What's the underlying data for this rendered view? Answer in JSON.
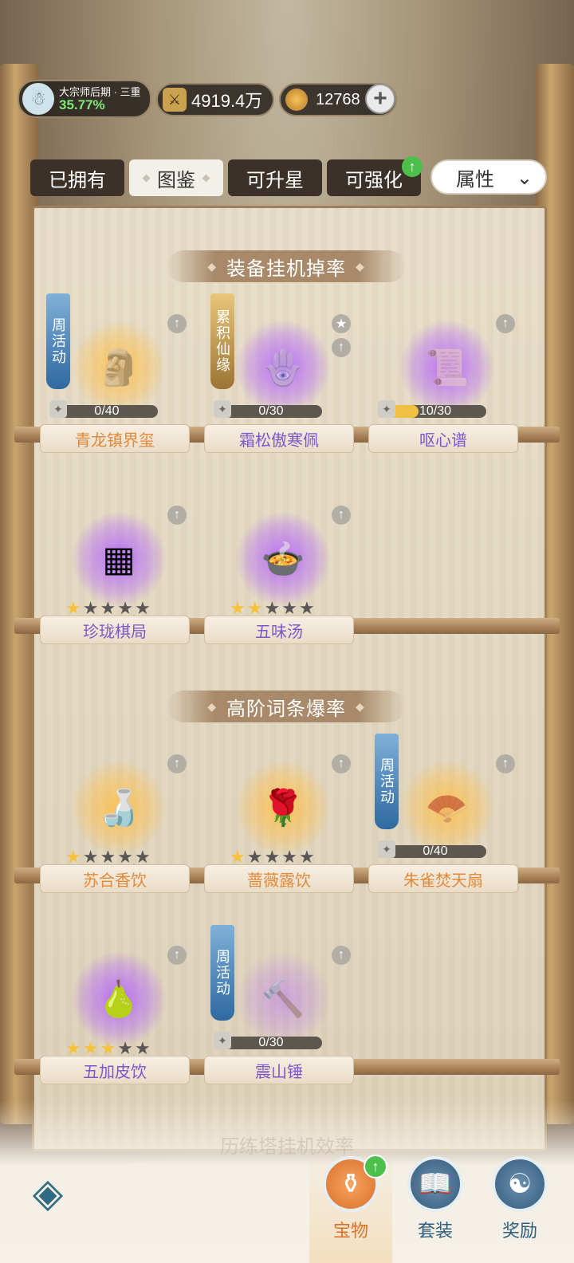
{
  "header": {
    "player_rank": "大宗师后期 · 三重",
    "player_progress": "35.77%",
    "power": "4919.4万",
    "currency": "12768",
    "add_icon": "plus-icon"
  },
  "tabs": [
    {
      "label": "已拥有",
      "active": false
    },
    {
      "label": "图鉴",
      "active": true
    },
    {
      "label": "可升星",
      "active": false
    },
    {
      "label": "可强化",
      "active": false
    }
  ],
  "filter": {
    "selected": "属性"
  },
  "sections": [
    {
      "title": "装备挂机掉率",
      "items": [
        {
          "name": "青龙镇界玺",
          "fragments": "0/40",
          "fragment_progress": 0.0,
          "tag": "周活动",
          "rarity": "gold"
        },
        {
          "name": "霜松傲寒佩",
          "fragments": "0/30",
          "fragment_progress": 0.0,
          "tag": "累积仙缘",
          "rarity": "purple"
        },
        {
          "name": "呕心谱",
          "fragments": "10/30",
          "fragment_progress": 0.333,
          "rarity": "purple"
        },
        {
          "name": "珍珑棋局",
          "stars": 1,
          "max_stars": 5,
          "rarity": "purple"
        },
        {
          "name": "五味汤",
          "stars": 2,
          "max_stars": 5,
          "rarity": "purple"
        }
      ]
    },
    {
      "title": "高阶词条爆率",
      "items": [
        {
          "name": "苏合香饮",
          "stars": 1,
          "max_stars": 5,
          "rarity": "gold"
        },
        {
          "name": "蔷薇露饮",
          "stars": 1,
          "max_stars": 5,
          "rarity": "gold"
        },
        {
          "name": "朱雀焚天扇",
          "fragments": "0/40",
          "fragment_progress": 0.0,
          "tag": "周活动",
          "rarity": "gold"
        },
        {
          "name": "五加皮饮",
          "stars": 3,
          "max_stars": 5,
          "rarity": "purple"
        },
        {
          "name": "震山锤",
          "fragments": "0/30",
          "fragment_progress": 0.0,
          "tag": "周活动",
          "rarity": "purple"
        }
      ]
    }
  ],
  "faded_section_title": "历练塔挂机效率",
  "nav": {
    "treasure": "宝物",
    "set": "套装",
    "reward": "奖励"
  },
  "colors": {
    "purple_text": "#7b58c9",
    "orange_text": "#e08a3c",
    "star_on": "#f6c23c",
    "badge_green": "#4cc04a"
  }
}
